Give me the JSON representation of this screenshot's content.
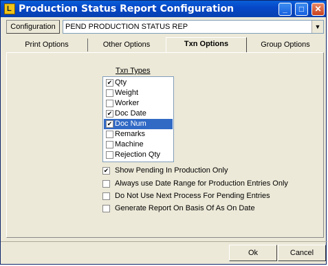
{
  "window": {
    "title": "Production Status Report Configuration"
  },
  "titlebar_buttons": {
    "minimize": "_",
    "maximize": "□",
    "close": "✕"
  },
  "config": {
    "label": "Configuration",
    "value": "PEND PRODUCTION STATUS REP"
  },
  "tabs": [
    {
      "label": "Print Options",
      "active": false
    },
    {
      "label": "Other Options",
      "active": false
    },
    {
      "label": "Txn Options",
      "active": true
    },
    {
      "label": "Group Options",
      "active": false
    }
  ],
  "txn_types": {
    "label": "Txn Types",
    "items": [
      {
        "label": "Qty",
        "checked": true,
        "selected": false
      },
      {
        "label": "Weight",
        "checked": false,
        "selected": false
      },
      {
        "label": "Worker",
        "checked": false,
        "selected": false
      },
      {
        "label": "Doc Date",
        "checked": true,
        "selected": false
      },
      {
        "label": "Doc Num",
        "checked": true,
        "selected": true
      },
      {
        "label": "Remarks",
        "checked": false,
        "selected": false
      },
      {
        "label": "Machine",
        "checked": false,
        "selected": false
      },
      {
        "label": "Rejection Qty",
        "checked": false,
        "selected": false
      }
    ]
  },
  "options": [
    {
      "label": "Show Pending In Production Only",
      "checked": true
    },
    {
      "label": "Always use Date Range for Production Entries Only",
      "checked": false
    },
    {
      "label": "Do Not Use Next Process For Pending Entries",
      "checked": false
    },
    {
      "label": "Generate Report On Basis Of As On Date",
      "checked": false
    }
  ],
  "buttons": {
    "ok": "Ok",
    "cancel": "Cancel"
  },
  "check_glyph": "✔",
  "colors": {
    "title_bar": "#0648c8",
    "selection": "#316ac5",
    "face": "#ece9d8"
  }
}
